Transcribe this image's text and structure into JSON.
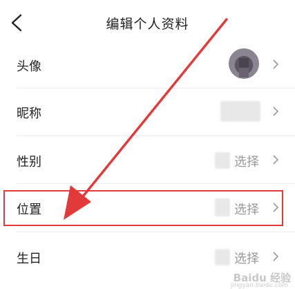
{
  "header": {
    "title": "编辑个人资料"
  },
  "rows": [
    {
      "label": "头像",
      "value": ""
    },
    {
      "label": "昵称",
      "value": ""
    },
    {
      "label": "性别",
      "value": "选择"
    },
    {
      "label": "位置",
      "value": "选择"
    },
    {
      "label": "生日",
      "value": "选择"
    }
  ],
  "watermark": {
    "text": "Baidu 经验",
    "sub": "jingyan.baidu.com"
  },
  "colors": {
    "highlight": "#e23a3a",
    "arrow": "#e23a3a",
    "value_text": "#999999"
  }
}
